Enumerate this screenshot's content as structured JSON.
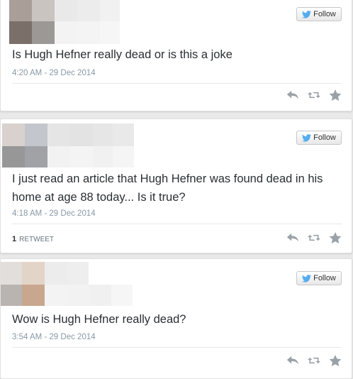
{
  "follow_label": "Follow",
  "colors": {
    "accent": "#55acee",
    "text": "#292f33",
    "meta": "#8899a6"
  },
  "tweets": [
    {
      "text": "Is Hugh Hefner really dead or is this a joke",
      "timestamp": "4:20 AM - 29 Dec 2014",
      "retweet_count": null,
      "retweet_label": null
    },
    {
      "text": "I just read an article that Hugh Hefner was found dead in his home at age 88 today... Is it true?",
      "timestamp": "4:18 AM - 29 Dec 2014",
      "retweet_count": "1",
      "retweet_label": "RETWEET"
    },
    {
      "text": "Wow is Hugh Hefner really dead?",
      "timestamp": "3:54 AM - 29 Dec 2014",
      "retweet_count": null,
      "retweet_label": null
    }
  ],
  "icons": {
    "follow": "twitter-bird-icon",
    "reply": "reply-icon",
    "retweet": "retweet-icon",
    "favorite": "star-icon"
  }
}
